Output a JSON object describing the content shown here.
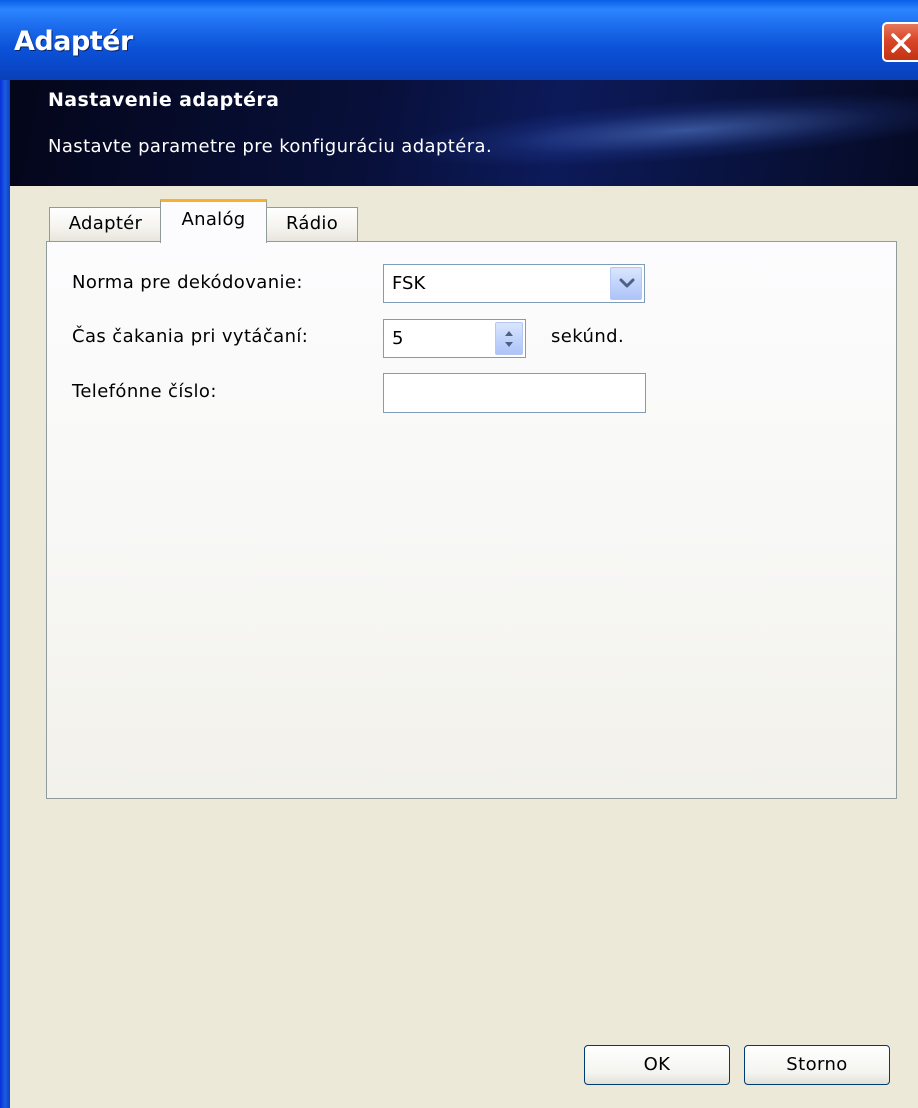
{
  "window": {
    "title": "Adaptér",
    "close_icon": "close-icon"
  },
  "banner": {
    "title": "Nastavenie adaptéra",
    "subtitle": "Nastavte parametre pre konfiguráciu adaptéra."
  },
  "tabs": [
    {
      "label": "Adaptér",
      "active": false
    },
    {
      "label": "Analóg",
      "active": true
    },
    {
      "label": "Rádio",
      "active": false
    }
  ],
  "form": {
    "decoding_label": "Norma pre dekódovanie:",
    "decoding_value": "FSK",
    "wait_label": "Čas čakania pri vytáčaní:",
    "wait_value": "5",
    "wait_unit": "sekúnd.",
    "phone_label": "Telefónne číslo:",
    "phone_value": ""
  },
  "buttons": {
    "ok": "OK",
    "cancel": "Storno"
  },
  "colors": {
    "titlebar": "#0a5fe8",
    "close": "#d9462a",
    "active_tab_accent": "#f7b12e"
  }
}
